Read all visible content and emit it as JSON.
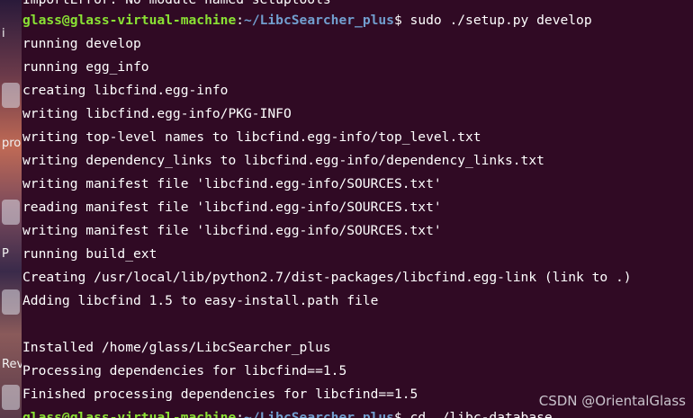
{
  "desktop": {
    "labels": [
      "i",
      "pro",
      "P",
      "Rev"
    ]
  },
  "terminal": {
    "top_partial": "ImportError: No module named setuptools",
    "prompt": {
      "user_host": "glass@glass-virtual-machine",
      "colon": ":",
      "path": "~/LibcSearcher_plus",
      "symbol": "$",
      "command": " sudo ./setup.py develop"
    },
    "output": [
      "running develop",
      "running egg_info",
      "creating libcfind.egg-info",
      "writing libcfind.egg-info/PKG-INFO",
      "writing top-level names to libcfind.egg-info/top_level.txt",
      "writing dependency_links to libcfind.egg-info/dependency_links.txt",
      "writing manifest file 'libcfind.egg-info/SOURCES.txt'",
      "reading manifest file 'libcfind.egg-info/SOURCES.txt'",
      "writing manifest file 'libcfind.egg-info/SOURCES.txt'",
      "running build_ext",
      "Creating /usr/local/lib/python2.7/dist-packages/libcfind.egg-link (link to .)",
      "Adding libcfind 1.5 to easy-install.path file",
      "",
      "Installed /home/glass/LibcSearcher_plus",
      "Processing dependencies for libcfind==1.5",
      "Finished processing dependencies for libcfind==1.5"
    ],
    "bottom_prompt": {
      "user_host": "glass@glass-virtual-machine",
      "colon": ":",
      "path": "~/LibcSearcher_plus",
      "symbol": "$",
      "command": " cd ./libc-database"
    }
  },
  "watermark": "CSDN @OrientalGlass"
}
